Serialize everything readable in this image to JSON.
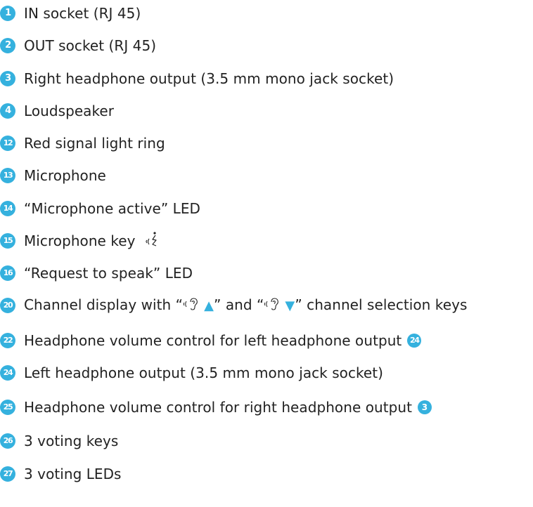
{
  "legend": {
    "items": [
      {
        "num": "1",
        "text": "IN socket (RJ 45)"
      },
      {
        "num": "2",
        "text": "OUT socket (RJ 45)"
      },
      {
        "num": "3",
        "text": "Right headphone output (3.5 mm mono jack socket)"
      },
      {
        "num": "4",
        "text": "Loudspeaker"
      },
      {
        "num": "12",
        "text": "Red signal light ring"
      },
      {
        "num": "13",
        "text": "Microphone"
      },
      {
        "num": "14",
        "text": "“Microphone active” LED"
      },
      {
        "num": "15",
        "text": "Microphone key"
      },
      {
        "num": "16",
        "text": "“Request to speak” LED"
      },
      {
        "num": "20",
        "part1": "Channel display with “",
        "part2": "” and “",
        "part3": "” channel selection keys",
        "up": "▲",
        "down": "▼"
      },
      {
        "num": "22",
        "text": "Headphone volume control for left headphone output",
        "ref": "24"
      },
      {
        "num": "24",
        "text": "Left headphone output (3.5 mm mono jack socket)"
      },
      {
        "num": "25",
        "text": "Headphone volume control for right headphone output",
        "ref": "3"
      },
      {
        "num": "26",
        "text": "3 voting keys"
      },
      {
        "num": "27",
        "text": "3 voting LEDs"
      }
    ]
  },
  "colors": {
    "badge": "#35b1de",
    "text": "#222222"
  },
  "icons": {
    "microphone_key": "microphone-speak-icon",
    "channel": "listen-ear-icon"
  }
}
